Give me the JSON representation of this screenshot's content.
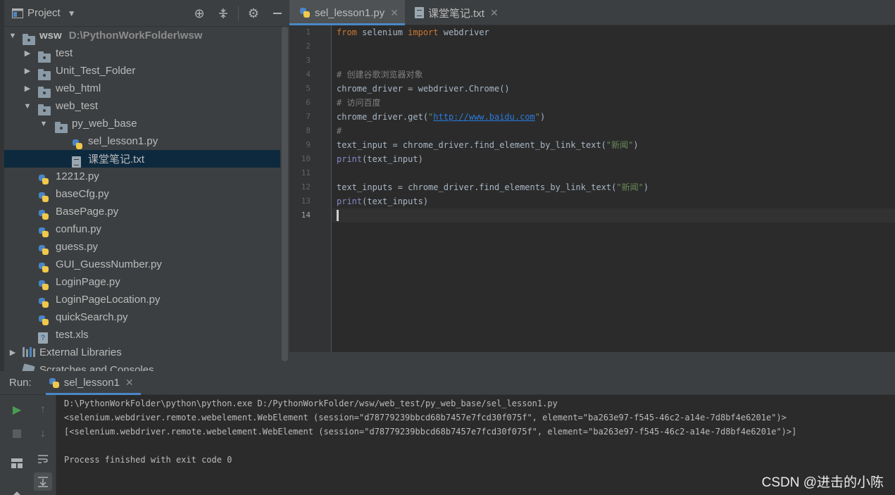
{
  "project_panel": {
    "title": "Project",
    "header_icons": [
      "crosshair-icon",
      "collapse-icon",
      "gear-icon",
      "minimize-icon"
    ],
    "tree": [
      {
        "label": "wsw",
        "path": "D:\\PythonWorkFolder\\wsw",
        "type": "folder",
        "expanded": true,
        "level": 0
      },
      {
        "label": "test",
        "type": "folder",
        "expanded": false,
        "level": 1
      },
      {
        "label": "Unit_Test_Folder",
        "type": "folder",
        "expanded": false,
        "level": 1
      },
      {
        "label": "web_html",
        "type": "folder",
        "expanded": false,
        "level": 1
      },
      {
        "label": "web_test",
        "type": "folder",
        "expanded": true,
        "level": 1
      },
      {
        "label": "py_web_base",
        "type": "folder",
        "expanded": true,
        "level": 2
      },
      {
        "label": "sel_lesson1.py",
        "type": "py",
        "level": 3
      },
      {
        "label": "课堂笔记.txt",
        "type": "txt",
        "level": 3,
        "selected": true
      },
      {
        "label": "12212.py",
        "type": "py",
        "level": 1
      },
      {
        "label": "baseCfg.py",
        "type": "py",
        "level": 1
      },
      {
        "label": "BasePage.py",
        "type": "py",
        "level": 1
      },
      {
        "label": "confun.py",
        "type": "py",
        "level": 1
      },
      {
        "label": "guess.py",
        "type": "py",
        "level": 1
      },
      {
        "label": "GUI_GuessNumber.py",
        "type": "py",
        "level": 1
      },
      {
        "label": "LoginPage.py",
        "type": "py",
        "level": 1
      },
      {
        "label": "LoginPageLocation.py",
        "type": "py",
        "level": 1
      },
      {
        "label": "quickSearch.py",
        "type": "py",
        "level": 1
      },
      {
        "label": "test.xls",
        "type": "xls",
        "level": 1
      },
      {
        "label": "External Libraries",
        "type": "lib",
        "expanded": false,
        "level": 0
      },
      {
        "label": "Scratches and Consoles",
        "type": "scratch",
        "level": 0
      }
    ]
  },
  "editor": {
    "tabs": [
      {
        "label": "sel_lesson1.py",
        "icon": "python-file-icon",
        "active": true
      },
      {
        "label": "课堂笔记.txt",
        "icon": "text-file-icon",
        "active": false
      }
    ],
    "line_numbers": [
      "1",
      "2",
      "3",
      "4",
      "5",
      "6",
      "7",
      "8",
      "9",
      "10",
      "11",
      "12",
      "13",
      "14"
    ],
    "current_line": 14,
    "code": [
      [
        {
          "t": "from",
          "c": "kw"
        },
        {
          "t": " selenium ",
          "c": ""
        },
        {
          "t": "import",
          "c": "kw"
        },
        {
          "t": " webdriver",
          "c": ""
        }
      ],
      [],
      [],
      [
        {
          "t": "# 创建谷歌浏览器对象",
          "c": "cm"
        }
      ],
      [
        {
          "t": "chrome_driver = webdriver.Chrome()",
          "c": ""
        }
      ],
      [
        {
          "t": "# 访问百度",
          "c": "cm"
        }
      ],
      [
        {
          "t": "chrome_driver.get(",
          "c": ""
        },
        {
          "t": "\"",
          "c": "str"
        },
        {
          "t": "http://www.baidu.com",
          "c": "url"
        },
        {
          "t": "\"",
          "c": "str"
        },
        {
          "t": ")",
          "c": ""
        }
      ],
      [
        {
          "t": "#",
          "c": "cm"
        }
      ],
      [
        {
          "t": "text_input = chrome_driver.find_element_by_link_text(",
          "c": ""
        },
        {
          "t": "\"新闻\"",
          "c": "str"
        },
        {
          "t": ")",
          "c": ""
        }
      ],
      [
        {
          "t": "print",
          "c": "bi"
        },
        {
          "t": "(text_input)",
          "c": ""
        }
      ],
      [],
      [
        {
          "t": "text_inputs = chrome_driver.find_elements_by_link_text(",
          "c": ""
        },
        {
          "t": "\"新闻\"",
          "c": "str"
        },
        {
          "t": ")",
          "c": ""
        }
      ],
      [
        {
          "t": "print",
          "c": "bi"
        },
        {
          "t": "(text_inputs)",
          "c": ""
        }
      ],
      []
    ]
  },
  "run_panel": {
    "label": "Run:",
    "tab_label": "sel_lesson1",
    "tools": [
      "rerun-icon",
      "stop-icon",
      "layout-icon",
      "pin-icon",
      "scroll-up-icon",
      "scroll-down-icon",
      "soft-wrap-icon",
      "scroll-to-end-icon"
    ],
    "console": [
      "D:\\PythonWorkFolder\\python\\python.exe D:/PythonWorkFolder/wsw/web_test/py_web_base/sel_lesson1.py",
      "<selenium.webdriver.remote.webelement.WebElement (session=\"d78779239bbcd68b7457e7fcd30f075f\", element=\"ba263e97-f545-46c2-a14e-7d8bf4e6201e\")>",
      "[<selenium.webdriver.remote.webelement.WebElement (session=\"d78779239bbcd68b7457e7fcd30f075f\", element=\"ba263e97-f545-46c2-a14e-7d8bf4e6201e\")>]",
      "",
      "Process finished with exit code 0"
    ]
  },
  "watermark": "CSDN @进击的小陈",
  "colors": {
    "accent": "#4a88c7",
    "selection": "#0d293e",
    "keyword": "#cc7832",
    "comment": "#808080",
    "string": "#6a8759",
    "link": "#287bde"
  }
}
